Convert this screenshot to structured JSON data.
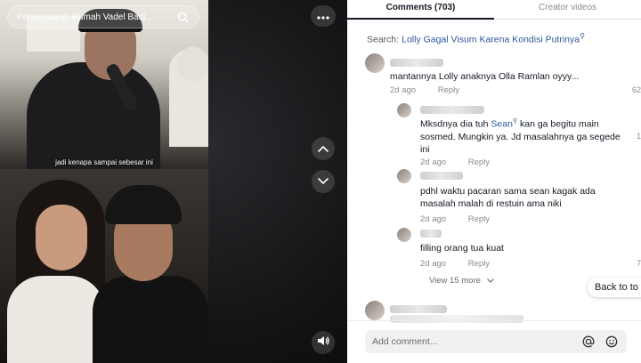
{
  "video": {
    "search_text": "Penampakan Rumah Vadel Badj...",
    "caption": "jadi kenapa sampai sebesar ini"
  },
  "tabs": [
    {
      "label": "Comments (703)",
      "active": true
    },
    {
      "label": "Creator videos",
      "active": false
    }
  ],
  "search": {
    "prefix": "Search:",
    "query": "Lolly Gagal Visum Karena Kondisi Putrinya",
    "icon": "search-icon"
  },
  "comments": [
    {
      "text": "mantannya Lolly anaknya Olla Ramlan oyyy...",
      "age": "2d ago",
      "reply": "Reply",
      "side_count": "62"
    },
    {
      "text_before": "Mksdnya dia tuh ",
      "mention": "Sean",
      "text_after": " kan ga begitu main sosmed. Mungkin ya. Jd masalahnya ga segede ini",
      "age": "2d ago",
      "reply": "Reply",
      "side_count": "1"
    },
    {
      "text": "pdhl waktu pacaran sama sean kagak ada masalah malah di restuin ama niki",
      "age": "2d ago",
      "reply": "Reply"
    },
    {
      "text": "filling orang tua kuat",
      "age": "2d ago",
      "reply": "Reply",
      "side_count": "7"
    }
  ],
  "view_more": "View 15 more",
  "back_to_top": "Back to to",
  "input": {
    "placeholder": "Add comment..."
  },
  "colors": {
    "link": "#2b5797",
    "text": "#161823",
    "muted": "#8a8a8a"
  }
}
